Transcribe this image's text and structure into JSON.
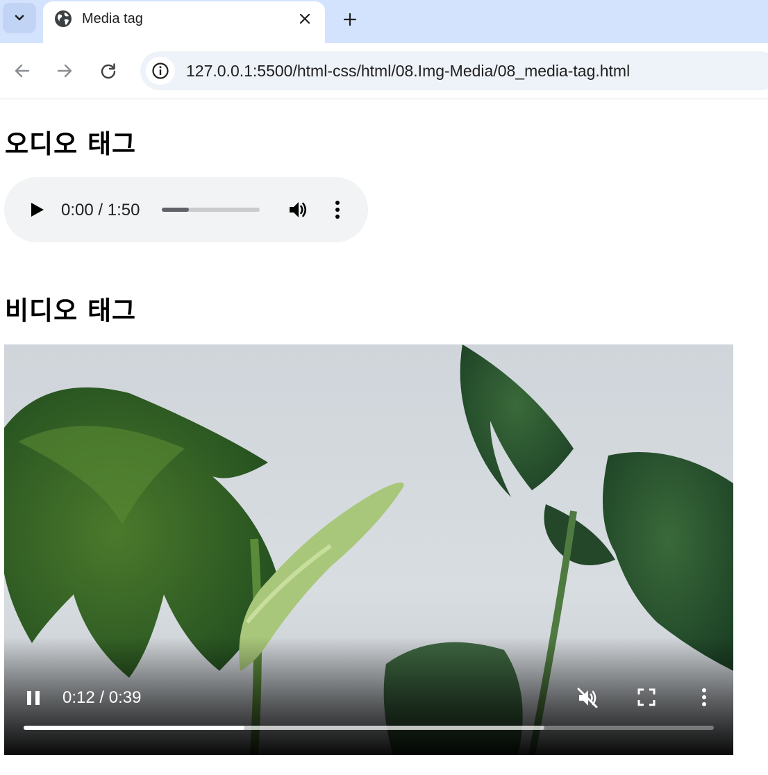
{
  "browser": {
    "tab": {
      "title": "Media tag"
    },
    "address_bar": {
      "url": "127.0.0.1:5500/html-css/html/08.Img-Media/08_media-tag.html"
    }
  },
  "page": {
    "audio_heading": "오디오 태그",
    "audio_player": {
      "time": "0:00 / 1:50",
      "progress_fraction": 0.28,
      "state": "paused"
    },
    "video_heading": "비디오 태그",
    "video_player": {
      "time": "0:12 / 0:39",
      "played_fraction": 0.32,
      "buffered_fraction": 0.755,
      "state": "playing",
      "muted": true
    }
  },
  "icons": {
    "tab_search": "chevron-down-icon",
    "favicon": "globe-icon",
    "close": "close-icon",
    "new_tab": "plus-icon",
    "back": "arrow-left-icon",
    "forward": "arrow-right-icon",
    "reload": "reload-icon",
    "site_info": "info-icon",
    "audio_play": "play-icon",
    "audio_volume": "volume-icon",
    "audio_more": "more-vert-icon",
    "video_pause": "pause-icon",
    "video_mute": "volume-muted-icon",
    "video_fullscreen": "fullscreen-icon",
    "video_more": "more-vert-icon"
  },
  "colors": {
    "tabstrip": "#d3e3fd",
    "omnibox": "#eef2f9",
    "audio_bg": "#f1f3f4"
  }
}
